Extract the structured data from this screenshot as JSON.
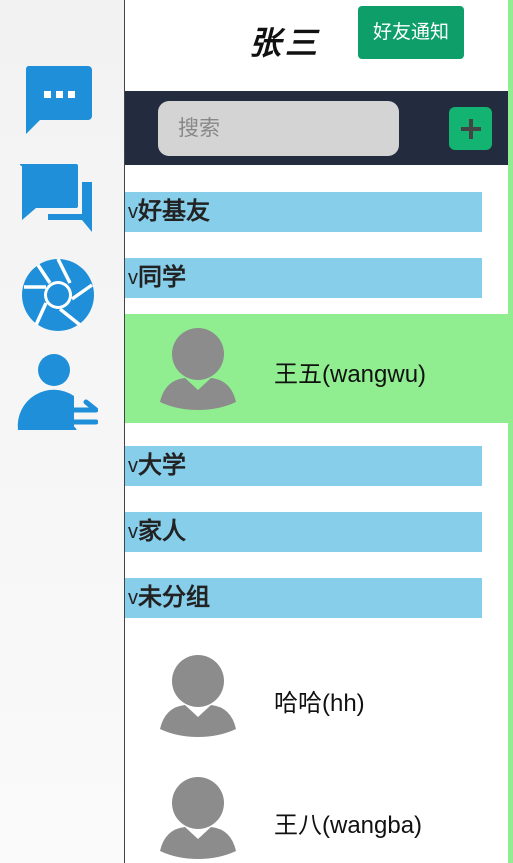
{
  "header": {
    "user_name": "张三",
    "notify_label": "好友通知"
  },
  "search": {
    "placeholder": "搜索",
    "add_label": "+"
  },
  "sidebar": {
    "items": [
      {
        "icon": "chat-bubble-icon",
        "label": ""
      },
      {
        "icon": "conversations-icon",
        "label": ""
      },
      {
        "icon": "aperture-icon",
        "label": ""
      },
      {
        "icon": "user-switch-icon",
        "label": ""
      }
    ],
    "accent_color": "#1e8fd8"
  },
  "groups": [
    {
      "label": "好基友",
      "chevron": "v"
    },
    {
      "label": "同学",
      "chevron": "v"
    },
    {
      "label": "大学",
      "chevron": "v"
    },
    {
      "label": "家人",
      "chevron": "v"
    },
    {
      "label": "未分组",
      "chevron": "v"
    }
  ],
  "friends": [
    {
      "name": "王五(wangwu)",
      "group": "同学",
      "selected": true
    },
    {
      "name": "哈哈(hh)",
      "group": "未分组",
      "selected": false
    },
    {
      "name": "王八(wangba)",
      "group": "未分组",
      "selected": false
    }
  ],
  "colors": {
    "group_bg": "#87ceeb",
    "selected_bg": "#90ee90",
    "notify_bg": "#0e9e69",
    "searchbar_bg": "#232b3e",
    "add_bg": "#13b371"
  }
}
